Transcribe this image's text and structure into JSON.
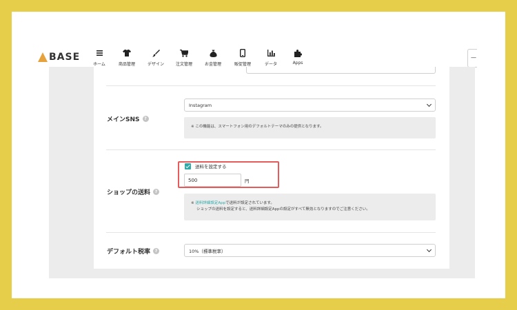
{
  "brand": {
    "logo_text": "BASE"
  },
  "nav": [
    {
      "label": "ホーム",
      "icon": "menu-icon"
    },
    {
      "label": "商品管理",
      "icon": "shirt-icon"
    },
    {
      "label": "デザイン",
      "icon": "brush-icon"
    },
    {
      "label": "注文管理",
      "icon": "cart-icon"
    },
    {
      "label": "お金管理",
      "icon": "money-bag-icon"
    },
    {
      "label": "販促管理",
      "icon": "phone-icon"
    },
    {
      "label": "データ",
      "icon": "bar-chart-icon"
    },
    {
      "label": "Apps",
      "icon": "puzzle-icon"
    }
  ],
  "header_right": {
    "label": "—"
  },
  "settings": {
    "main_sns": {
      "label": "メインSNS",
      "help": "?",
      "selected": "Instagram",
      "note": "※ この機能は、スマートフォン用のデフォルトテーマのみの提供となります。"
    },
    "shipping": {
      "label": "ショップの送料",
      "help": "?",
      "checkbox_label": "送料を設定する",
      "checked": true,
      "amount": "500",
      "currency": "円",
      "note_prefix": "※ ",
      "note_link": "送料詳細設定App",
      "note_line1_rest": "で送料が設定されています。",
      "note_line2": "ショップの送料を設定すると、送料詳細設定Appの設定がすべて無効となりますのでご注意ください。"
    },
    "tax": {
      "label": "デフォルト税率",
      "help": "?",
      "selected": "10%（標準税率）"
    }
  },
  "colors": {
    "background_border": "#e6cd4a",
    "accent": "#2fa8a8",
    "highlight": "#e55b5b"
  }
}
